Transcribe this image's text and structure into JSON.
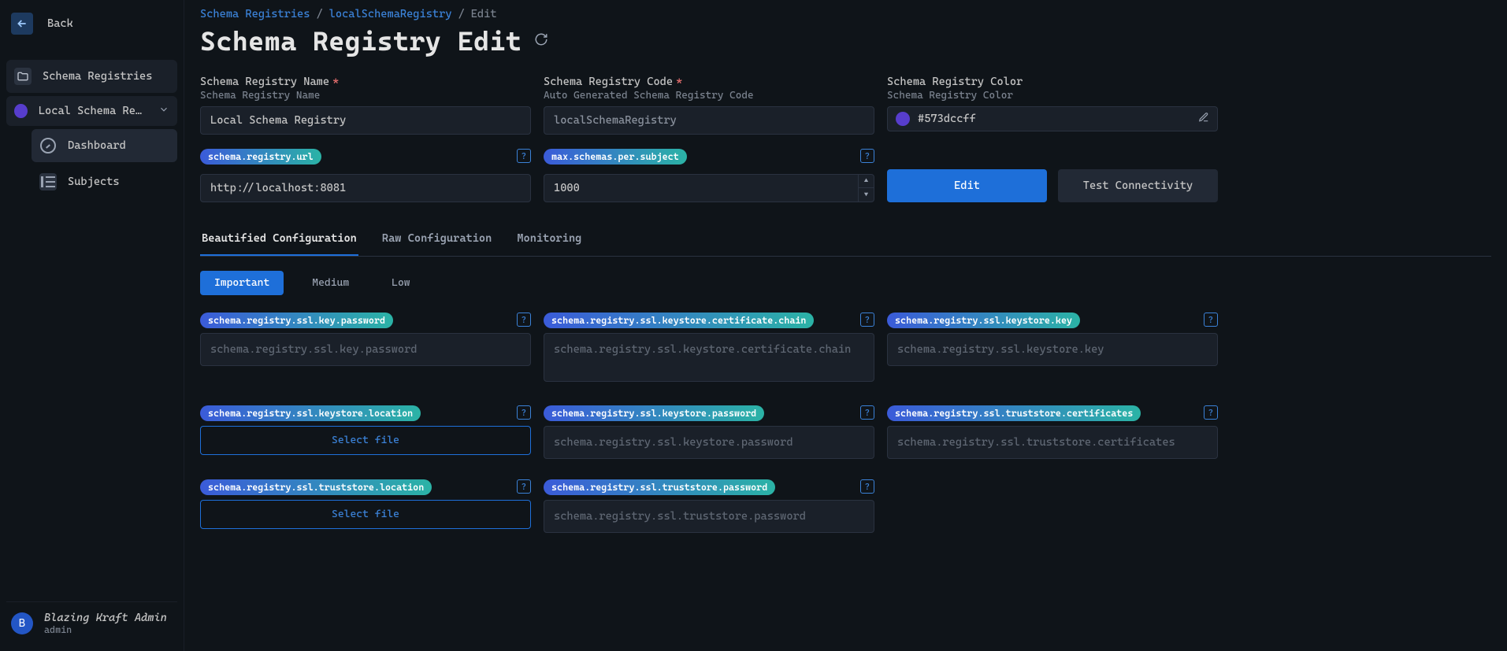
{
  "sidebar": {
    "back_label": "Back",
    "nav0_label": "Schema Registries",
    "nav1_label": "Local Schema Regi…",
    "nav2a_label": "Dashboard",
    "nav2b_label": "Subjects",
    "user_name": "Blazing Kraft Admin",
    "user_role": "admin",
    "user_initial": "B"
  },
  "breadcrumb": {
    "a": "Schema Registries",
    "b": "localSchemaRegistry",
    "c": "Edit"
  },
  "page_title": "Schema Registry Edit",
  "fields": {
    "name": {
      "label": "Schema Registry Name",
      "hint": "Schema Registry Name",
      "value": "Local Schema Registry"
    },
    "code": {
      "label": "Schema Registry Code",
      "hint": "Auto Generated Schema Registry Code",
      "value": "localSchemaRegistry"
    },
    "color": {
      "label": "Schema Registry Color",
      "hint": "Schema Registry Color",
      "value": "#573dccff",
      "hex": "#573dcc"
    },
    "url": {
      "pill": "schema.registry.url",
      "value": "http://localhost:8081"
    },
    "max": {
      "pill": "max.schemas.per.subject",
      "value": "1000"
    }
  },
  "buttons": {
    "edit": "Edit",
    "test": "Test Connectivity"
  },
  "tabs": {
    "a": "Beautified Configuration",
    "b": "Raw Configuration",
    "c": "Monitoring"
  },
  "pill_tabs": {
    "a": "Important",
    "b": "Medium",
    "c": "Low"
  },
  "config": [
    {
      "pill": "schema.registry.ssl.key.password",
      "placeholder": "schema.registry.ssl.key.password",
      "type": "text"
    },
    {
      "pill": "schema.registry.ssl.keystore.certificate.chain",
      "placeholder": "schema.registry.ssl.keystore.certificate.chain",
      "type": "textarea"
    },
    {
      "pill": "schema.registry.ssl.keystore.key",
      "placeholder": "schema.registry.ssl.keystore.key",
      "type": "text"
    },
    {
      "pill": "schema.registry.ssl.keystore.location",
      "placeholder": "",
      "type": "file",
      "file_label": "Select file"
    },
    {
      "pill": "schema.registry.ssl.keystore.password",
      "placeholder": "schema.registry.ssl.keystore.password",
      "type": "text"
    },
    {
      "pill": "schema.registry.ssl.truststore.certificates",
      "placeholder": "schema.registry.ssl.truststore.certificates",
      "type": "text"
    },
    {
      "pill": "schema.registry.ssl.truststore.location",
      "placeholder": "",
      "type": "file",
      "file_label": "Select file"
    },
    {
      "pill": "schema.registry.ssl.truststore.password",
      "placeholder": "schema.registry.ssl.truststore.password",
      "type": "text"
    }
  ]
}
